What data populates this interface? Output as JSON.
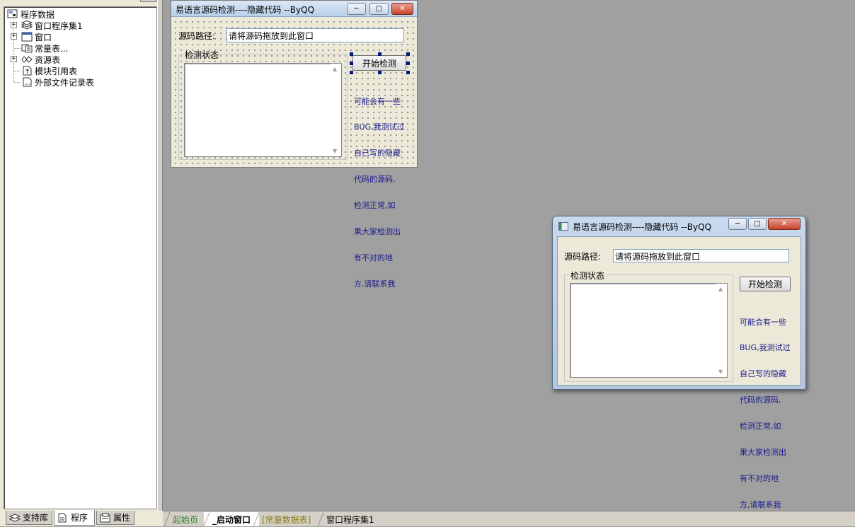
{
  "left_panel": {
    "tree": {
      "root": "程序数据",
      "items": [
        {
          "label": "窗口程序集1",
          "expandable": true
        },
        {
          "label": "窗口",
          "expandable": true
        },
        {
          "label": "常量表...",
          "expandable": false
        },
        {
          "label": "资源表",
          "expandable": true
        },
        {
          "label": "模块引用表",
          "expandable": false
        },
        {
          "label": "外部文件记录表",
          "expandable": false
        }
      ]
    },
    "bottom_tabs": [
      {
        "label": "支持库",
        "icon": "library-icon"
      },
      {
        "label": "程序",
        "icon": "program-icon",
        "active": true
      },
      {
        "label": "属性",
        "icon": "properties-icon"
      }
    ]
  },
  "form": {
    "title": "易语言源码检测----隐藏代码 --ByQQ",
    "path_label": "源码路径:",
    "path_value": "请将源码拖放到此窗口",
    "group_label": "检测状态",
    "start_button": "开始检测",
    "note_lines": [
      "可能会有一些",
      "BUG,我测试过",
      "自己写的隐藏",
      "代码的源码,",
      "检测正常,如",
      "果大家检测出",
      "有不对的地",
      "方,请联系我"
    ]
  },
  "doc_tabs": [
    {
      "label": "起始页",
      "style": "home"
    },
    {
      "label": "_启动窗口",
      "style": "active"
    },
    {
      "label": "[常量数据表]",
      "style": "const"
    },
    {
      "label": "窗口程序集1",
      "style": "normal"
    }
  ],
  "colors": {
    "workspace": "#a0a0a0",
    "note_text": "#1a1a8c",
    "selection_handle": "#001a80",
    "close_button": "#c7432a"
  }
}
